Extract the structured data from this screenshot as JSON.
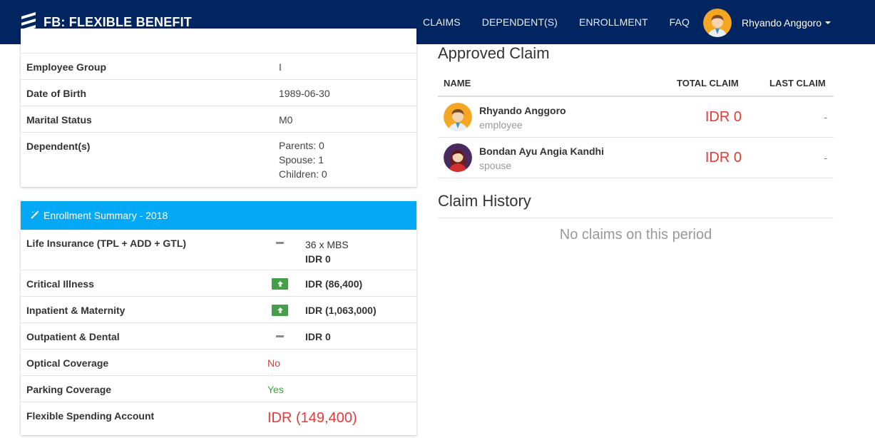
{
  "app": {
    "brand": "FB: FLEXIBLE BENEFIT"
  },
  "nav": {
    "items": [
      "CLAIMS",
      "DEPENDENT(S)",
      "ENROLLMENT",
      "FAQ"
    ],
    "user": "Rhyando Anggoro"
  },
  "profile": {
    "rows": [
      {
        "label": "Employee Group",
        "value": "I"
      },
      {
        "label": "Date of Birth",
        "value": "1989-06-30"
      },
      {
        "label": "Marital Status",
        "value": "M0"
      },
      {
        "label": "Dependent(s)",
        "lines": [
          "Parents: 0",
          "Spouse: 1",
          "Children: 0"
        ]
      }
    ]
  },
  "enrollment": {
    "title": "Enrollment Summary - 2018",
    "rows": [
      {
        "label": "Life Insurance (TPL + ADD + GTL)",
        "indicator": "dash-icon",
        "line1": "36 x MBS",
        "amount": "IDR 0"
      },
      {
        "label": "Critical Illness",
        "indicator": "arrow-up-icon",
        "amount": "IDR (86,400)"
      },
      {
        "label": "Inpatient & Maternity",
        "indicator": "arrow-up-icon",
        "amount": "IDR (1,063,000)"
      },
      {
        "label": "Outpatient & Dental",
        "indicator": "dash-icon",
        "amount": "IDR 0"
      },
      {
        "label": "Optical Coverage",
        "value": "No"
      },
      {
        "label": "Parking Coverage",
        "value": "Yes"
      },
      {
        "label": "Flexible Spending Account",
        "value": "IDR (149,400)"
      }
    ]
  },
  "approved": {
    "title": "Approved Claim",
    "columns": [
      "NAME",
      "TOTAL CLAIM",
      "LAST CLAIM"
    ],
    "rows": [
      {
        "name": "Rhyando Anggoro",
        "role": "employee",
        "total": "IDR 0",
        "last": "-"
      },
      {
        "name": "Bondan Ayu Angia Kandhi",
        "role": "spouse",
        "total": "IDR 0",
        "last": "-"
      }
    ]
  },
  "history": {
    "title": "Claim History",
    "empty": "No claims on this period"
  },
  "colors": {
    "navbar": "#002561",
    "accent": "#03a9f4",
    "danger": "#e53935",
    "success": "#43a047"
  }
}
